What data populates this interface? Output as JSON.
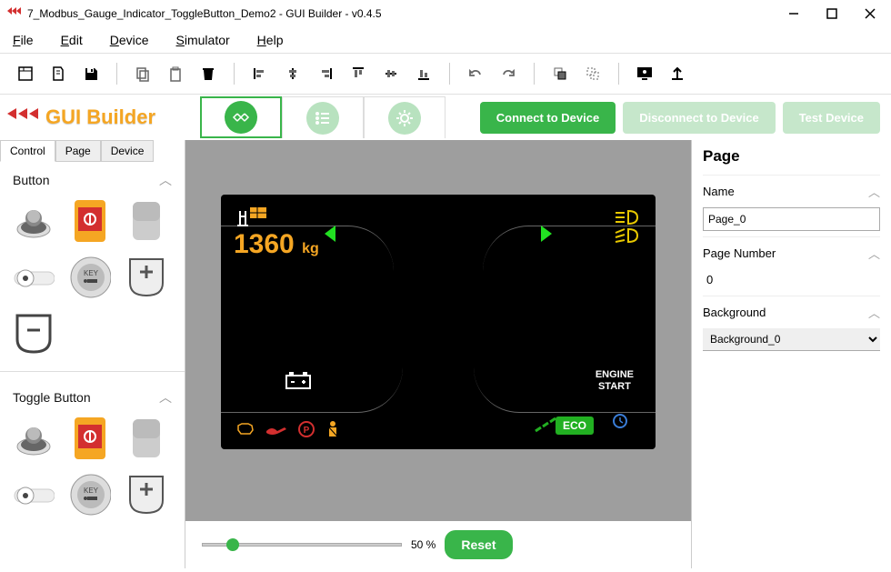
{
  "window": {
    "title": "7_Modbus_Gauge_Indicator_ToggleButton_Demo2 - GUI Builder - v0.4.5"
  },
  "menu": {
    "file": "File",
    "edit": "Edit",
    "device": "Device",
    "simulator": "Simulator",
    "help": "Help"
  },
  "logo": {
    "text": "GUI Builder"
  },
  "device_buttons": {
    "connect": "Connect to Device",
    "disconnect": "Disconnect to Device",
    "test": "Test Device"
  },
  "left": {
    "tabs": [
      "Control",
      "Page",
      "Device"
    ],
    "active_tab": 0,
    "sections": {
      "button": "Button",
      "toggle": "Toggle Button"
    }
  },
  "dashboard": {
    "weight_value": "1360",
    "weight_unit": "kg",
    "engine_start_l1": "ENGINE",
    "engine_start_l2": "START",
    "eco": "ECO"
  },
  "slider": {
    "percent": "50 %",
    "reset": "Reset"
  },
  "right": {
    "title": "Page",
    "name_label": "Name",
    "name_value": "Page_0",
    "pagenum_label": "Page Number",
    "pagenum_value": "0",
    "bg_label": "Background",
    "bg_value": "Background_0"
  }
}
